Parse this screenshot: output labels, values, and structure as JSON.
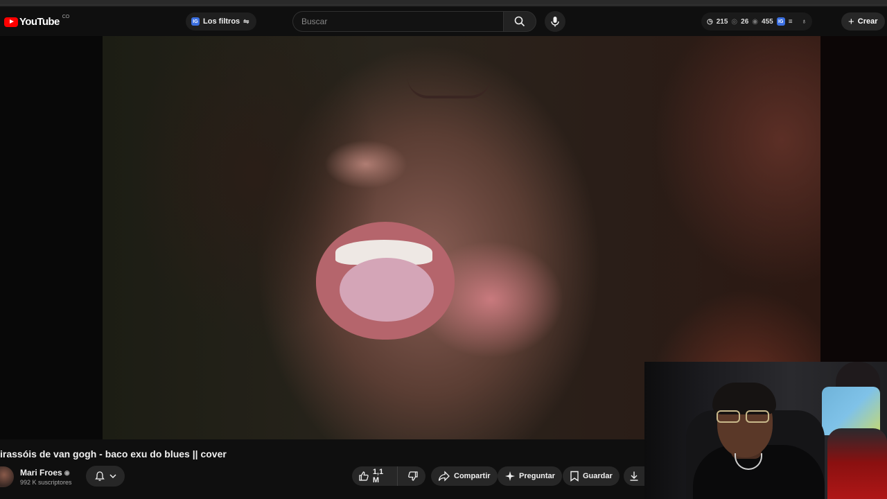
{
  "header": {
    "logo_text": "YouTube",
    "country_code": "CO",
    "filters_label": "Los filtros",
    "filters_badge": "IG",
    "search_placeholder": "Buscar",
    "stats": [
      "215",
      "26",
      "455"
    ],
    "stats_badge": "IG",
    "create_label": "Crear"
  },
  "video": {
    "title": "irassóis de van gogh - baco exu do blues || cover"
  },
  "channel": {
    "name": "Mari Froes",
    "subscribers": "992 K suscriptores"
  },
  "actions": {
    "likes": "1,1 M",
    "share_label": "Compartir",
    "ask_label": "Preguntar",
    "save_label": "Guardar"
  },
  "icons": [
    "youtube-logo-icon",
    "tune-icon",
    "search-icon",
    "mic-icon",
    "clock-icon",
    "eye-icon",
    "list-icon",
    "bulb-icon",
    "plus-icon",
    "bell-icon",
    "chevron-down-icon",
    "thumbs-up-icon",
    "thumbs-down-icon",
    "share-icon",
    "sparkle-icon",
    "bookmark-icon",
    "download-icon"
  ],
  "colors": {
    "brand_red": "#ff0000",
    "background": "#0f0f0f",
    "pill": "#272727",
    "badge_blue": "#3b6fe0"
  }
}
